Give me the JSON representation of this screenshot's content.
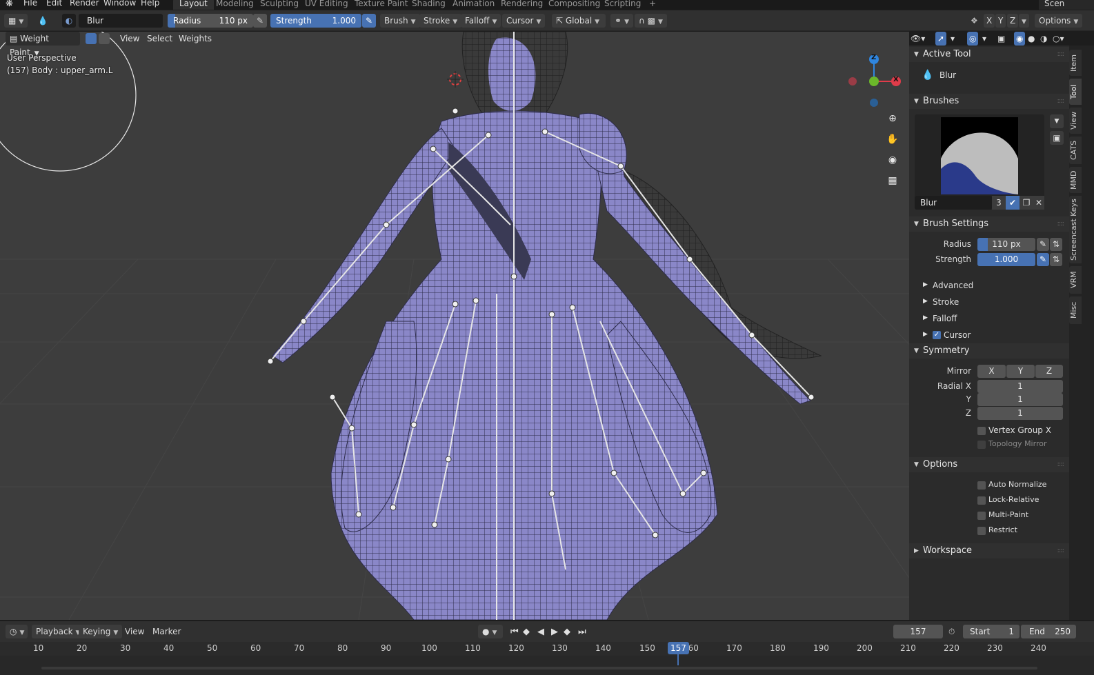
{
  "topbar": {
    "menus": [
      "File",
      "Edit",
      "Render",
      "Window",
      "Help"
    ],
    "workspaces": [
      "Layout",
      "Modeling",
      "Sculpting",
      "UV Editing",
      "Texture Paint",
      "Shading",
      "Animation",
      "Rendering",
      "Compositing",
      "Scripting"
    ],
    "active_workspace": "Layout",
    "add_tab": "+",
    "scene_label": "Scen"
  },
  "toolheader": {
    "brush_name": "Blur",
    "radius_label": "Radius",
    "radius_value": "110 px",
    "strength_label": "Strength",
    "strength_value": "1.000",
    "dropdowns": [
      "Brush",
      "Stroke",
      "Falloff",
      "Cursor"
    ],
    "orientation": "Global",
    "axes": [
      "X",
      "Y",
      "Z"
    ],
    "options_label": "Options"
  },
  "viewport": {
    "mode": "Weight Paint",
    "menus": [
      "View",
      "Select",
      "Weights"
    ],
    "perspective": "User Perspective",
    "object_info": "(157) Body : upper_arm.L",
    "gizmo": {
      "z": "Z",
      "x": "X"
    }
  },
  "sidebar": {
    "active_tool_header": "Active Tool",
    "active_tool_name": "Blur",
    "brushes_header": "Brushes",
    "brush_name": "Blur",
    "brush_users": "3",
    "brush_settings_header": "Brush Settings",
    "radius_label": "Radius",
    "radius_value": "110 px",
    "strength_label": "Strength",
    "strength_value": "1.000",
    "subpanels": [
      "Advanced",
      "Stroke",
      "Falloff",
      "Cursor"
    ],
    "symmetry_header": "Symmetry",
    "mirror_label": "Mirror",
    "mirror_axes": [
      "X",
      "Y",
      "Z"
    ],
    "radial_x_label": "Radial X",
    "radial_x": "1",
    "radial_y_label": "Y",
    "radial_y": "1",
    "radial_z_label": "Z",
    "radial_z": "1",
    "vertex_group_x": "Vertex Group X",
    "topology_mirror": "Topology Mirror",
    "options_header": "Options",
    "options": [
      "Auto Normalize",
      "Lock-Relative",
      "Multi-Paint",
      "Restrict"
    ],
    "workspace_header": "Workspace"
  },
  "vtabs": [
    "Item",
    "Tool",
    "View",
    "CATS",
    "MMD",
    "Screencast Keys",
    "VRM",
    "Misc"
  ],
  "timeline": {
    "menus": [
      "Playback",
      "Keying",
      "View",
      "Marker"
    ],
    "current_frame": "157",
    "start_label": "Start",
    "start": "1",
    "end_label": "End",
    "end": "250",
    "ticks": [
      "10",
      "20",
      "30",
      "40",
      "50",
      "60",
      "70",
      "80",
      "90",
      "100",
      "110",
      "120",
      "130",
      "140",
      "150",
      "160",
      "170",
      "180",
      "190",
      "200",
      "210",
      "220",
      "230",
      "240"
    ],
    "playhead_label": "157"
  }
}
